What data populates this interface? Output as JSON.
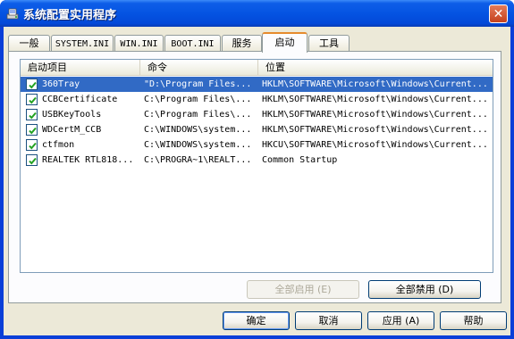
{
  "window": {
    "title": "系统配置实用程序",
    "close_glyph": "✕"
  },
  "tabs": [
    {
      "label": "一般",
      "active": false
    },
    {
      "label": "SYSTEM.INI",
      "active": false
    },
    {
      "label": "WIN.INI",
      "active": false
    },
    {
      "label": "BOOT.INI",
      "active": false
    },
    {
      "label": "服务",
      "active": false
    },
    {
      "label": "启动",
      "active": true
    },
    {
      "label": "工具",
      "active": false
    }
  ],
  "list": {
    "columns": [
      "启动项目",
      "命令",
      "位置"
    ],
    "rows": [
      {
        "checked": true,
        "name": "360Tray",
        "command": "\"D:\\Program Files...",
        "location": "HKLM\\SOFTWARE\\Microsoft\\Windows\\Current...",
        "selected": true
      },
      {
        "checked": true,
        "name": "CCBCertificate",
        "command": "C:\\Program Files\\...",
        "location": "HKLM\\SOFTWARE\\Microsoft\\Windows\\Current...",
        "selected": false
      },
      {
        "checked": true,
        "name": "USBKeyTools",
        "command": "C:\\Program Files\\...",
        "location": "HKLM\\SOFTWARE\\Microsoft\\Windows\\Current...",
        "selected": false
      },
      {
        "checked": true,
        "name": "WDCertM_CCB",
        "command": "C:\\WINDOWS\\system...",
        "location": "HKLM\\SOFTWARE\\Microsoft\\Windows\\Current...",
        "selected": false
      },
      {
        "checked": true,
        "name": "ctfmon",
        "command": "C:\\WINDOWS\\system...",
        "location": "HKCU\\SOFTWARE\\Microsoft\\Windows\\Current...",
        "selected": false
      },
      {
        "checked": true,
        "name": "REALTEK RTL818...",
        "command": "C:\\PROGRA~1\\REALT...",
        "location": "Common Startup",
        "selected": false
      }
    ]
  },
  "panel_buttons": {
    "enable_all": "全部启用 (E)",
    "disable_all": "全部禁用 (D)"
  },
  "dialog_buttons": {
    "ok": "确定",
    "cancel": "取消",
    "apply": "应用 (A)",
    "help": "帮助"
  },
  "icons": {
    "title_icon": "system-config-icon",
    "checkbox_check": "check-icon"
  },
  "colors": {
    "titlebar": "#0554e2",
    "selection": "#316ac5",
    "tab_accent": "#e68b2c",
    "check": "#21a121"
  }
}
